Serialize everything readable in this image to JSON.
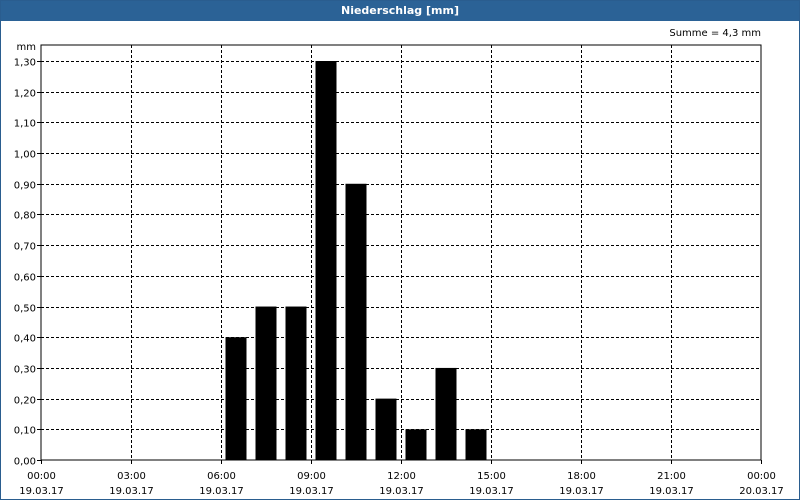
{
  "window": {
    "title": "Niederschlag [mm]"
  },
  "annotation": "Summe = 4,3 mm",
  "chart_data": {
    "type": "bar",
    "title": "Niederschlag [mm]",
    "ylabel": "mm",
    "xlabel": "",
    "ylim": [
      0,
      1.3
    ],
    "grid": true,
    "x_ticks": [
      {
        "time": "00:00",
        "date": "19.03.17"
      },
      {
        "time": "03:00",
        "date": "19.03.17"
      },
      {
        "time": "06:00",
        "date": "19.03.17"
      },
      {
        "time": "09:00",
        "date": "19.03.17"
      },
      {
        "time": "12:00",
        "date": "19.03.17"
      },
      {
        "time": "15:00",
        "date": "19.03.17"
      },
      {
        "time": "18:00",
        "date": "19.03.17"
      },
      {
        "time": "21:00",
        "date": "19.03.17"
      },
      {
        "time": "00:00",
        "date": "20.03.17"
      }
    ],
    "y_ticks": [
      "0,00",
      "0,10",
      "0,20",
      "0,30",
      "0,40",
      "0,50",
      "0,60",
      "0,70",
      "0,80",
      "0,90",
      "1,00",
      "1,10",
      "1,20",
      "1,30"
    ],
    "bars": [
      {
        "hour": 7,
        "value": 0.4
      },
      {
        "hour": 8,
        "value": 0.5
      },
      {
        "hour": 9,
        "value": 0.5
      },
      {
        "hour": 10,
        "value": 1.3
      },
      {
        "hour": 11,
        "value": 0.9
      },
      {
        "hour": 12,
        "value": 0.2
      },
      {
        "hour": 13,
        "value": 0.1
      },
      {
        "hour": 14,
        "value": 0.3
      },
      {
        "hour": 15,
        "value": 0.1
      }
    ]
  },
  "colors": {
    "titlebar": "#2b6296",
    "bars": "#000000",
    "grid": "#000000",
    "background": "#ffffff"
  }
}
